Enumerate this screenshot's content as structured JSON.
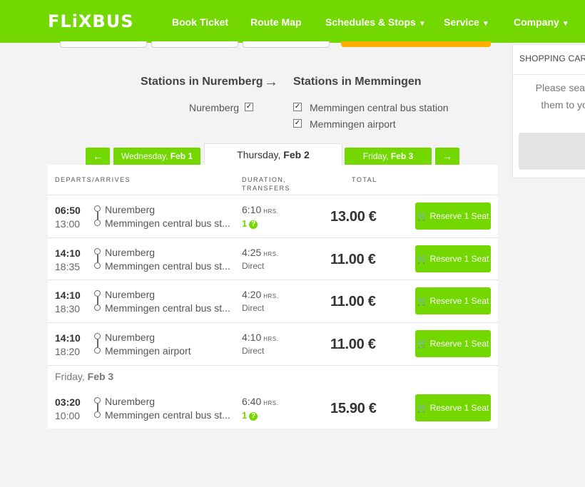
{
  "header": {
    "logo": "FLiXBUS",
    "nav": [
      {
        "label": "Book Ticket",
        "dropdown": false
      },
      {
        "label": "Route Map",
        "dropdown": false
      },
      {
        "label": "Schedules & Stops",
        "dropdown": true
      },
      {
        "label": "Service",
        "dropdown": true
      },
      {
        "label": "Company",
        "dropdown": true
      }
    ]
  },
  "cart": {
    "title": "SHOPPING CAR",
    "message_line1": "Please search",
    "message_line2": "them to you"
  },
  "stations": {
    "from_heading": "Stations in Nuremberg",
    "arrow": "→",
    "to_heading": "Stations in Memmingen",
    "from_items": [
      {
        "label": "Nuremberg",
        "checked": true
      }
    ],
    "to_items": [
      {
        "label": "Memmingen central bus station",
        "checked": true
      },
      {
        "label": "Memmingen airport",
        "checked": true
      }
    ]
  },
  "days": {
    "prev_arrow": "←",
    "prev_weekday": "Wednesday,",
    "prev_date": "Feb 1",
    "current_weekday": "Thursday,",
    "current_date": "Feb 2",
    "next_weekday": "Friday,",
    "next_date": "Feb 3",
    "next_arrow": "→"
  },
  "table": {
    "col_departs": "DEPARTS/ARRIVES",
    "col_duration_1": "DURATION,",
    "col_duration_2": "TRANSFERS",
    "col_total": "TOTAL",
    "hrs_label": "HRS.",
    "reserve_label": "Reserve 1 Seat",
    "day_separator_weekday": "Friday,",
    "day_separator_date": "Feb 3",
    "rows": [
      {
        "dep": "06:50",
        "arr": "13:00",
        "from": "Nuremberg",
        "to": "Memmingen central bus st...",
        "duration": "6:10",
        "transfers": "1",
        "price": "13.00 €"
      },
      {
        "dep": "14:10",
        "arr": "18:35",
        "from": "Nuremberg",
        "to": "Memmingen central bus st...",
        "duration": "4:25",
        "transfers": "Direct",
        "price": "11.00 €"
      },
      {
        "dep": "14:10",
        "arr": "18:30",
        "from": "Nuremberg",
        "to": "Memmingen central bus st...",
        "duration": "4:20",
        "transfers": "Direct",
        "price": "11.00 €"
      },
      {
        "dep": "14:10",
        "arr": "18:20",
        "from": "Nuremberg",
        "to": "Memmingen airport",
        "duration": "4:10",
        "transfers": "Direct",
        "price": "11.00 €"
      },
      {
        "dep": "03:20",
        "arr": "10:00",
        "from": "Nuremberg",
        "to": "Memmingen central bus st...",
        "duration": "6:40",
        "transfers": "1",
        "price": "15.90 €"
      }
    ]
  },
  "colors": {
    "brand_green": "#73d700",
    "search_orange": "#ffad00"
  }
}
